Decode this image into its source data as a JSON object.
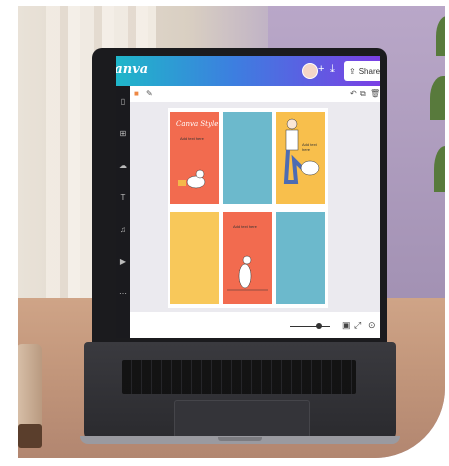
{
  "app": {
    "name": "Canva"
  },
  "header": {
    "share_label": "Share"
  },
  "design": {
    "panels": [
      {
        "title": "Canva Style",
        "text": "Add text here",
        "color": "#f26b4f"
      },
      {
        "title": "",
        "text": "",
        "color": "#6cb9cc"
      },
      {
        "title": "",
        "text": "Add text here",
        "color": "#f8bf4c"
      },
      {
        "title": "",
        "text": "",
        "color": "#f8c85a"
      },
      {
        "title": "",
        "text": "Add text here",
        "color": "#f26b4f"
      },
      {
        "title": "",
        "text": "",
        "color": "#6cb9cc"
      }
    ]
  },
  "icons": [
    "undo-icon",
    "copy-icon",
    "trash-icon",
    "templates-icon",
    "elements-icon",
    "uploads-icon",
    "text-icon",
    "audio-icon",
    "videos-icon",
    "more-icon"
  ],
  "colors": {
    "brand_gradient_start": "#1fb6c9",
    "brand_gradient_end": "#7b3fe4"
  }
}
